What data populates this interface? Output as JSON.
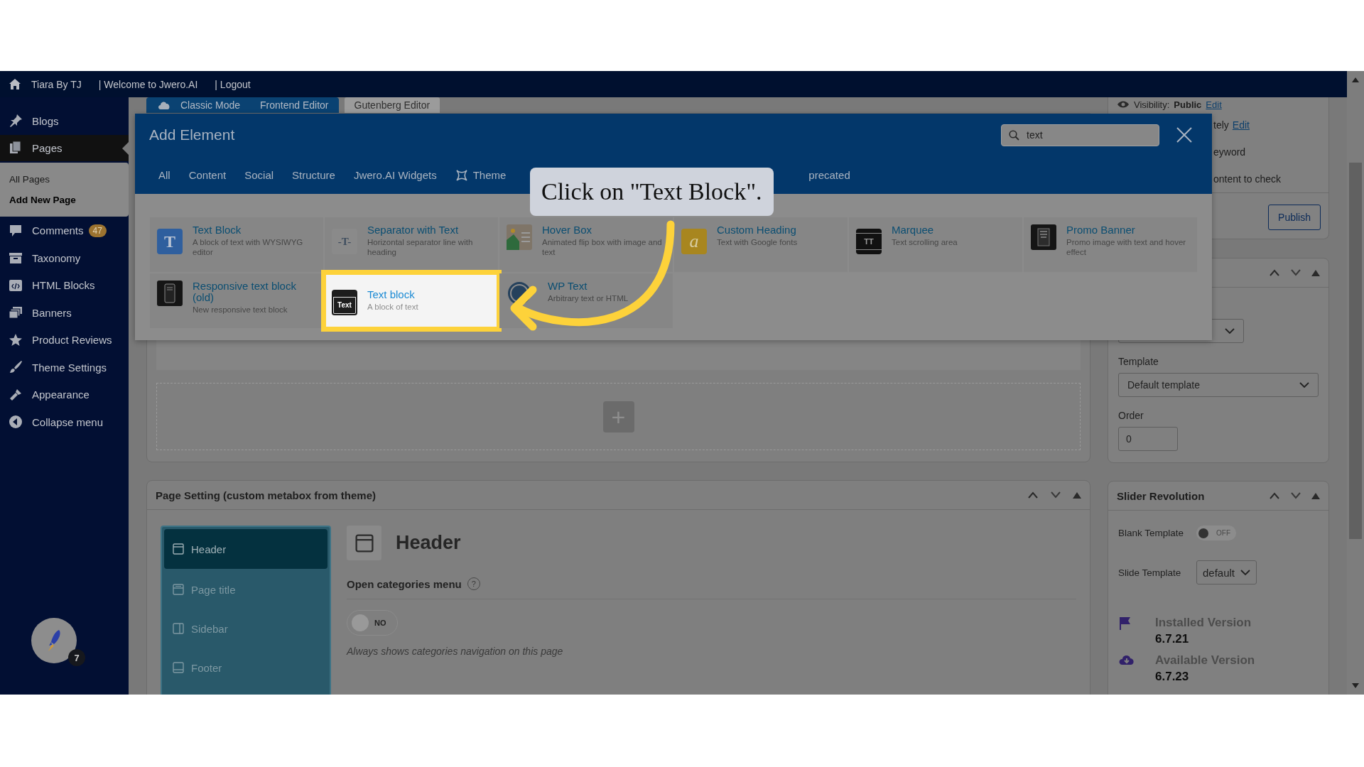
{
  "admin_bar": {
    "site_name": "Tiara By TJ",
    "links": [
      "| Welcome to Jwero.AI",
      "| Logout"
    ]
  },
  "sidebar": {
    "items": [
      {
        "label": "Blogs",
        "selected": false
      },
      {
        "label": "Pages",
        "selected": true,
        "children": [
          {
            "label": "All Pages",
            "selected": false
          },
          {
            "label": "Add New Page",
            "selected": true
          }
        ]
      },
      {
        "label": "Comments",
        "selected": false,
        "badge": "47"
      },
      {
        "label": "Taxonomy",
        "selected": false
      },
      {
        "label": "HTML Blocks",
        "selected": false
      },
      {
        "label": "Banners",
        "selected": false
      },
      {
        "label": "Product Reviews",
        "selected": false
      },
      {
        "label": "Theme Settings",
        "selected": false
      },
      {
        "label": "Appearance",
        "selected": false
      },
      {
        "label": "Collapse menu",
        "selected": false
      }
    ],
    "launcher_badge": "7"
  },
  "editor_tabs": [
    {
      "label": "Classic Mode",
      "kind": "primary"
    },
    {
      "label": "Frontend Editor",
      "kind": "primary"
    },
    {
      "label": "Gutenberg Editor",
      "kind": "secondary"
    }
  ],
  "editor": {
    "add_button": "+"
  },
  "page_setting": {
    "title": "Page Setting (custom metabox from theme)",
    "tabs": [
      {
        "label": "Header",
        "selected": true
      },
      {
        "label": "Page title",
        "selected": false
      },
      {
        "label": "Sidebar",
        "selected": false
      },
      {
        "label": "Footer",
        "selected": false
      }
    ],
    "heading": "Header",
    "field": {
      "label": "Open categories menu",
      "help": "?",
      "toggle_text": "NO",
      "on": false,
      "description": "Always shows categories navigation on this page"
    }
  },
  "publish_box": {
    "visibility": {
      "label": "Visibility:",
      "value": "Public",
      "link": "Edit"
    },
    "lines": [
      {
        "text": "tely",
        "link": "Edit"
      },
      {
        "text": "eyword"
      },
      {
        "text": "ontent to check"
      }
    ],
    "button": "Publish"
  },
  "attributes_box": {
    "template_label": "Template",
    "template_value": "Default template",
    "order_label": "Order",
    "order_value": "0"
  },
  "slider_box": {
    "title": "Slider Revolution",
    "blank_template": {
      "label": "Blank Template",
      "toggle_text": "OFF",
      "on": false
    },
    "slide_template": {
      "label": "Slide Template",
      "value": "default"
    },
    "versions": [
      {
        "label": "Installed Version",
        "value": "6.7.21"
      },
      {
        "label": "Available Version",
        "value": "6.7.23"
      }
    ]
  },
  "modal": {
    "title": "Add Element",
    "search": {
      "value": "text"
    },
    "tabs": [
      {
        "label": "All",
        "kind": "plain"
      },
      {
        "label": "Content",
        "kind": "plain"
      },
      {
        "label": "Social",
        "kind": "plain"
      },
      {
        "label": "Structure",
        "kind": "plain"
      },
      {
        "label": "Jwero.AI Widgets",
        "kind": "plain"
      },
      {
        "label": "Theme",
        "kind": "with_icon"
      },
      {
        "label": "precated",
        "kind": "plain"
      }
    ],
    "elements": [
      {
        "title": "Text Block",
        "description": "A block of text with WYSIWYG editor",
        "icon_text": "T",
        "highlighted": false
      },
      {
        "title": "Separator with Text",
        "description": "Horizontal separator line with heading",
        "icon_text": "-T-",
        "highlighted": false
      },
      {
        "title": "Hover Box",
        "description": "Animated flip box with image and text",
        "highlighted": false
      },
      {
        "title": "Custom Heading",
        "description": "Text with Google fonts",
        "icon_text": "a",
        "highlighted": false
      },
      {
        "title": "Marquee",
        "description": "Text scrolling area",
        "icon_text": "TT",
        "highlighted": false
      },
      {
        "title": "Promo Banner",
        "description": "Promo image with text and hover effect",
        "highlighted": false
      },
      {
        "title": "Responsive text block (old)",
        "description": "New responsive text block",
        "highlighted": false
      },
      {
        "title": "Text block",
        "description": "A block of text",
        "icon_text": "Text",
        "highlighted": true
      },
      {
        "title": "WP Text",
        "description": "Arbitrary text or HTML",
        "highlighted": false
      }
    ]
  },
  "callout": {
    "text": "Click on \"Text Block\"."
  }
}
